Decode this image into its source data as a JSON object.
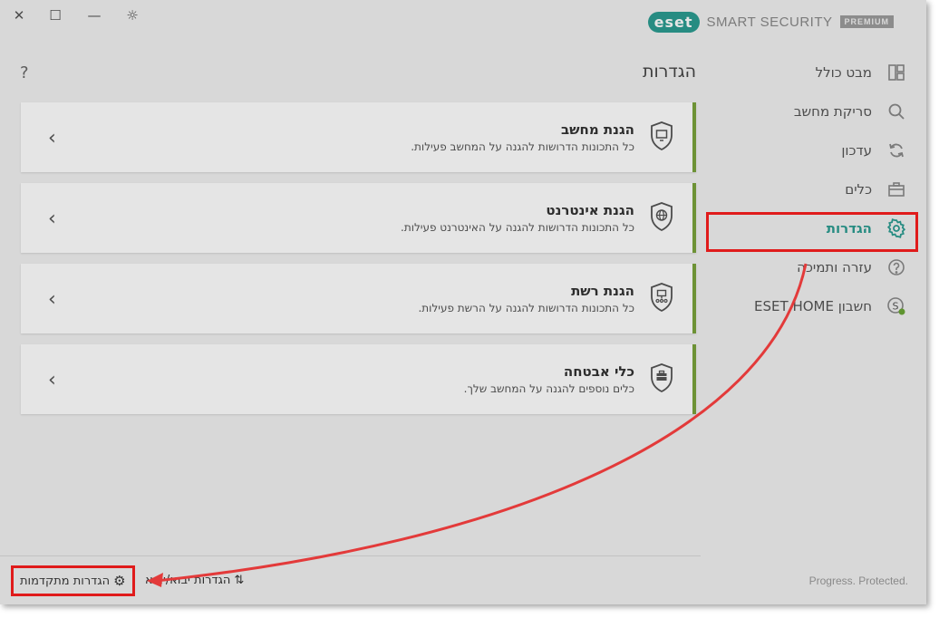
{
  "window": {
    "controls": {
      "close": "✕",
      "maximize": "☐",
      "theme": "☼"
    },
    "brand": {
      "badge": "eset",
      "product": "SMART SECURITY",
      "edition": "PREMIUM"
    }
  },
  "sidebar": {
    "items": [
      {
        "label": "מבט כולל",
        "icon": "dashboard-icon"
      },
      {
        "label": "סריקת מחשב",
        "icon": "search-icon"
      },
      {
        "label": "עדכון",
        "icon": "refresh-icon"
      },
      {
        "label": "כלים",
        "icon": "toolbox-icon"
      },
      {
        "label": "הגדרות",
        "icon": "gear-icon",
        "active": true
      },
      {
        "label": "עזרה ותמיכה",
        "icon": "help-icon"
      },
      {
        "label": "חשבון ESET HOME",
        "icon": "eset-home-icon"
      }
    ]
  },
  "main": {
    "title": "הגדרות",
    "help": "?",
    "cards": [
      {
        "title": "הגנת מחשב",
        "desc": "כל התכונות הדרושות להגנה על המחשב פעילות.",
        "icon": "computer-shield-icon"
      },
      {
        "title": "הגנת אינטרנט",
        "desc": "כל התכונות הדרושות להגנה על האינטרנט פעילות.",
        "icon": "globe-shield-icon"
      },
      {
        "title": "הגנת רשת",
        "desc": "כל התכונות הדרושות להגנה על הרשת פעילות.",
        "icon": "network-shield-icon"
      },
      {
        "title": "כלי אבטחה",
        "desc": "כלים נוספים להגנה על המחשב שלך.",
        "icon": "toolbox-shield-icon"
      }
    ]
  },
  "footer": {
    "advanced_settings": "הגדרות מתקדמות",
    "import_export": "הגדרות יבוא/יצוא",
    "tagline": "Progress. Protected."
  },
  "colors": {
    "accent": "#2c9c91",
    "status_green": "#7aa33c",
    "annotation_red": "#e01b1b"
  }
}
